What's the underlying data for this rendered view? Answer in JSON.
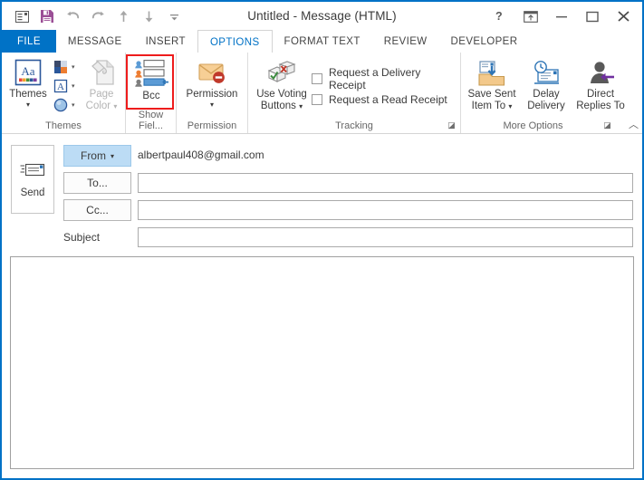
{
  "window": {
    "title": "Untitled - Message (HTML)",
    "accent_color": "#0072c6",
    "highlight_color": "#ee1c1c"
  },
  "quick_access": {
    "items": [
      {
        "name": "outlook-icon",
        "label": "Outlook"
      },
      {
        "name": "save-icon",
        "label": "Save"
      },
      {
        "name": "undo-icon",
        "label": "Undo"
      },
      {
        "name": "redo-icon",
        "label": "Redo"
      },
      {
        "name": "previous-item-icon",
        "label": "Previous Item"
      },
      {
        "name": "next-item-icon",
        "label": "Next Item"
      },
      {
        "name": "customize-qat-icon",
        "label": "Customize Quick Access Toolbar"
      }
    ]
  },
  "window_controls": {
    "help": "?",
    "ribbon_display": "Ribbon Display Options",
    "minimize": "Minimize",
    "maximize": "Maximize",
    "close": "Close"
  },
  "tabs": [
    {
      "label": "FILE",
      "active": false,
      "file": true
    },
    {
      "label": "MESSAGE",
      "active": false,
      "file": false
    },
    {
      "label": "INSERT",
      "active": false,
      "file": false
    },
    {
      "label": "OPTIONS",
      "active": true,
      "file": false
    },
    {
      "label": "FORMAT TEXT",
      "active": false,
      "file": false
    },
    {
      "label": "REVIEW",
      "active": false,
      "file": false
    },
    {
      "label": "DEVELOPER",
      "active": false,
      "file": false
    }
  ],
  "ribbon": {
    "groups": [
      {
        "name": "themes",
        "label": "Themes"
      },
      {
        "name": "show-fields",
        "label": "Show Fiel..."
      },
      {
        "name": "permission",
        "label": "Permission"
      },
      {
        "name": "tracking",
        "label": "Tracking"
      },
      {
        "name": "more-options",
        "label": "More Options"
      }
    ],
    "themes": {
      "themes_button": "Themes",
      "colors_button": "Colors",
      "fonts_button": "Fonts",
      "effects_button": "Effects",
      "page_color_line1": "Page",
      "page_color_line2": "Color",
      "page_color_disabled": true
    },
    "show_fields": {
      "bcc_button": "Bcc",
      "bcc_highlighted": true
    },
    "permission": {
      "permission_button": "Permission"
    },
    "tracking": {
      "use_voting_line1": "Use Voting",
      "use_voting_line2": "Buttons",
      "delivery_receipt": "Request a Delivery Receipt",
      "delivery_receipt_checked": false,
      "read_receipt": "Request a Read Receipt",
      "read_receipt_checked": false
    },
    "more_options": {
      "save_sent_line1": "Save Sent",
      "save_sent_line2": "Item To",
      "delay_line1": "Delay",
      "delay_line2": "Delivery",
      "direct_line1": "Direct",
      "direct_line2": "Replies To"
    }
  },
  "compose": {
    "send_button": "Send",
    "from_button": "From",
    "from_value": "albertpaul408@gmail.com",
    "to_button": "To...",
    "to_value": "",
    "cc_button": "Cc...",
    "cc_value": "",
    "subject_label": "Subject",
    "subject_value": "",
    "body_value": ""
  }
}
